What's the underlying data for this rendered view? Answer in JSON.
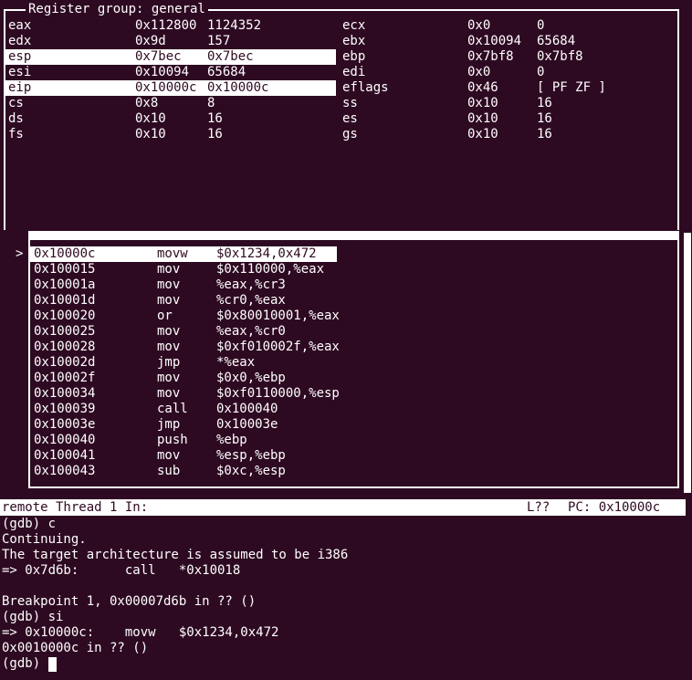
{
  "colors": {
    "background": "#2e0a22",
    "foreground": "#ffffff",
    "highlight_bg": "#ffffff",
    "highlight_fg": "#2e0a22"
  },
  "register_window": {
    "title": "Register group: general",
    "rows": [
      {
        "left": [
          "eax",
          "0x112800",
          "1124352"
        ],
        "right": [
          "ecx",
          "0x0",
          "0"
        ],
        "highlight_left": false
      },
      {
        "left": [
          "edx",
          "0x9d",
          "157"
        ],
        "right": [
          "ebx",
          "0x10094",
          "65684"
        ],
        "highlight_left": false
      },
      {
        "left": [
          "esp",
          "0x7bec",
          "0x7bec"
        ],
        "right": [
          "ebp",
          "0x7bf8",
          "0x7bf8"
        ],
        "highlight_left": true
      },
      {
        "left": [
          "esi",
          "0x10094",
          "65684"
        ],
        "right": [
          "edi",
          "0x0",
          "0"
        ],
        "highlight_left": false
      },
      {
        "left": [
          "eip",
          "0x10000c",
          "0x10000c"
        ],
        "right": [
          "eflags",
          "0x46",
          "[ PF ZF ]"
        ],
        "highlight_left": true
      },
      {
        "left": [
          "cs",
          "0x8",
          "8"
        ],
        "right": [
          "ss",
          "0x10",
          "16"
        ],
        "highlight_left": false
      },
      {
        "left": [
          "ds",
          "0x10",
          "16"
        ],
        "right": [
          "es",
          "0x10",
          "16"
        ],
        "highlight_left": false
      },
      {
        "left": [
          "fs",
          "0x10",
          "16"
        ],
        "right": [
          "gs",
          "0x10",
          "16"
        ],
        "highlight_left": false
      }
    ]
  },
  "assembly_window": {
    "current_line_marker": ">",
    "rows": [
      {
        "address": "0x10000c",
        "mnemonic": "movw",
        "operands": "$0x1234,0x472",
        "current": true
      },
      {
        "address": "0x100015",
        "mnemonic": "mov",
        "operands": "$0x110000,%eax",
        "current": false
      },
      {
        "address": "0x10001a",
        "mnemonic": "mov",
        "operands": "%eax,%cr3",
        "current": false
      },
      {
        "address": "0x10001d",
        "mnemonic": "mov",
        "operands": "%cr0,%eax",
        "current": false
      },
      {
        "address": "0x100020",
        "mnemonic": "or",
        "operands": "$0x80010001,%eax",
        "current": false
      },
      {
        "address": "0x100025",
        "mnemonic": "mov",
        "operands": "%eax,%cr0",
        "current": false
      },
      {
        "address": "0x100028",
        "mnemonic": "mov",
        "operands": "$0xf010002f,%eax",
        "current": false
      },
      {
        "address": "0x10002d",
        "mnemonic": "jmp",
        "operands": "*%eax",
        "current": false
      },
      {
        "address": "0x10002f",
        "mnemonic": "mov",
        "operands": "$0x0,%ebp",
        "current": false
      },
      {
        "address": "0x100034",
        "mnemonic": "mov",
        "operands": "$0xf0110000,%esp",
        "current": false
      },
      {
        "address": "0x100039",
        "mnemonic": "call",
        "operands": "0x100040",
        "current": false
      },
      {
        "address": "0x10003e",
        "mnemonic": "jmp",
        "operands": "0x10003e",
        "current": false
      },
      {
        "address": "0x100040",
        "mnemonic": "push",
        "operands": "%ebp",
        "current": false
      },
      {
        "address": "0x100041",
        "mnemonic": "mov",
        "operands": "%esp,%ebp",
        "current": false
      },
      {
        "address": "0x100043",
        "mnemonic": "sub",
        "operands": "$0xc,%esp",
        "current": false
      }
    ]
  },
  "status_bar": {
    "left": "remote Thread 1 In:",
    "line_indicator": "L??",
    "pc_indicator": "PC: 0x10000c"
  },
  "console": {
    "lines": [
      "(gdb) c",
      "Continuing.",
      "The target architecture is assumed to be i386",
      "=> 0x7d6b:      call   *0x10018",
      "",
      "Breakpoint 1, 0x00007d6b in ?? ()",
      "(gdb) si",
      "=> 0x10000c:    movw   $0x1234,0x472",
      "0x0010000c in ?? ()",
      "(gdb) "
    ],
    "prompt": "(gdb)"
  }
}
